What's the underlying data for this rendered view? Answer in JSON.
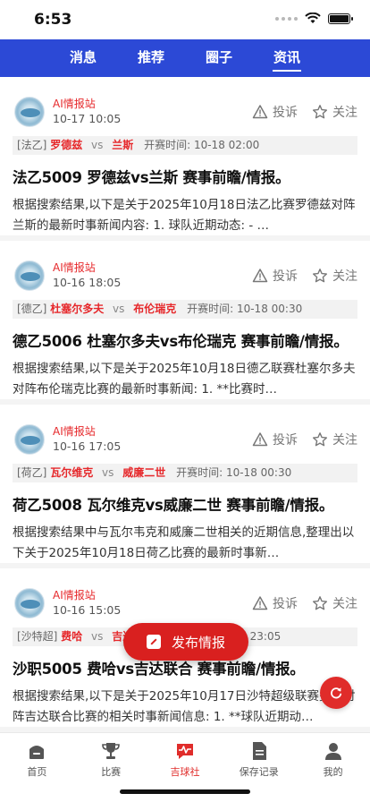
{
  "status": {
    "time": "6:53"
  },
  "top_tabs": [
    {
      "label": "消息",
      "active": false
    },
    {
      "label": "推荐",
      "active": false
    },
    {
      "label": "圈子",
      "active": false
    },
    {
      "label": "资讯",
      "active": true
    }
  ],
  "actions": {
    "report": "投诉",
    "follow": "关注",
    "report_icon": "warning-triangle-icon",
    "follow_icon": "star-icon"
  },
  "kickoff_label": "开赛时间:",
  "posts": [
    {
      "author": "AI情报站",
      "time": "10-17 10:05",
      "league": "[法乙]",
      "home": "罗德兹",
      "vs": "vs",
      "away": "兰斯",
      "kickoff": "10-18 02:00",
      "title": "法乙5009 罗德兹vs兰斯 赛事前瞻/情报。",
      "summary": "根据搜索结果,以下是关于2025年10月18日法乙比赛罗德兹对阵兰斯的最新时事新闻内容: 1. 球队近期动态: - …"
    },
    {
      "author": "AI情报站",
      "time": "10-16 18:05",
      "league": "[德乙]",
      "home": "杜塞尔多夫",
      "vs": "vs",
      "away": "布伦瑞克",
      "kickoff": "10-18 00:30",
      "title": "德乙5006 杜塞尔多夫vs布伦瑞克 赛事前瞻/情报。",
      "summary": "根据搜索结果,以下是关于2025年10月18日德乙联赛杜塞尔多夫对阵布伦瑞克比赛的最新时事新闻: 1. **比赛时…"
    },
    {
      "author": "AI情报站",
      "time": "10-16 17:05",
      "league": "[荷乙]",
      "home": "瓦尔维克",
      "vs": "vs",
      "away": "威廉二世",
      "kickoff": "10-18 00:30",
      "title": "荷乙5008 瓦尔维克vs威廉二世 赛事前瞻/情报。",
      "summary": "根据搜索结果中与瓦尔韦克和威廉二世相关的近期信息,整理出以下关于2025年10月18日荷乙比赛的最新时事新…"
    },
    {
      "author": "AI情报站",
      "time": "10-16 15:05",
      "league": "[沙特超]",
      "home": "费哈",
      "vs": "vs",
      "away": "吉达联合",
      "kickoff": "10-17 23:05",
      "title": "沙职5005 费哈vs吉达联合 赛事前瞻/情报。",
      "summary": "根据搜索结果,以下是关于2025年10月17日沙特超级联赛费哈对阵吉达联合比赛的相关时事新闻信息: 1. **球队近期动…"
    }
  ],
  "fab": {
    "label": "发布情报",
    "icon": "edit-icon"
  },
  "refresh": {
    "icon": "refresh-icon"
  },
  "tabbar": [
    {
      "label": "首页",
      "icon": "home-icon",
      "active": false
    },
    {
      "label": "比赛",
      "icon": "trophy-icon",
      "active": false
    },
    {
      "label": "吉球社",
      "icon": "pulse-chat-icon",
      "active": true
    },
    {
      "label": "保存记录",
      "icon": "document-icon",
      "active": false
    },
    {
      "label": "我的",
      "icon": "user-icon",
      "active": false
    }
  ],
  "colors": {
    "nav_blue": "#2c49d6",
    "accent_red": "#e02c2a",
    "team_red": "#e6282b"
  }
}
